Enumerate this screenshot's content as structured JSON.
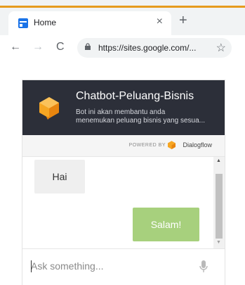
{
  "browser": {
    "tab_title": "Home",
    "tab_close": "×",
    "new_tab": "+",
    "back": "←",
    "forward": "→",
    "reload": "C",
    "url": "https://sites.google.com/...",
    "bookmark": "☆"
  },
  "chat_widget": {
    "title": "Chatbot-Peluang-Bisnis",
    "description_line1": "Bot ini akan membantu anda",
    "description_line2": "menemukan peluang bisnis yang sesua...",
    "powered_by": "POWERED BY",
    "provider": "Dialogflow",
    "messages": [
      {
        "sender": "user",
        "text": "Hai"
      },
      {
        "sender": "bot",
        "text": "Salam!"
      }
    ],
    "input_placeholder": "Ask something..."
  },
  "colors": {
    "header_bg": "#2c2f39",
    "bot_bubble": "#a7d07d",
    "user_bubble": "#efefef",
    "logo_orange": "#f6a623"
  },
  "icons": {
    "tab_favicon": "google-sites-icon",
    "lock": "lock-icon",
    "mic": "microphone-icon",
    "bot_logo": "dialogflow-icon"
  }
}
